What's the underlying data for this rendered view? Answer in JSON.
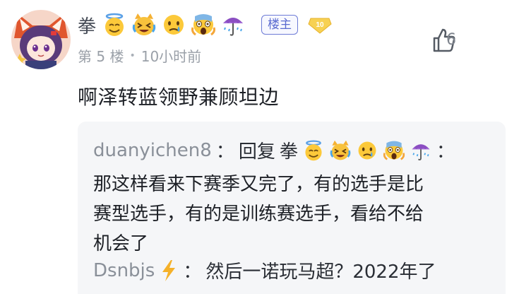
{
  "comment": {
    "username": "拳",
    "username_emojis": [
      "smiling-face-with-halo",
      "crying-cat",
      "sad-relieved-face",
      "screaming-face",
      "umbrella-rain"
    ],
    "op_badge": "楼主",
    "level": "10",
    "floor": "第 5 楼",
    "time": "10小时前",
    "like_count": "6",
    "content": "啊泽转蓝领野兼顾坦边"
  },
  "replies": [
    {
      "author": "duanyichen8",
      "separator": "：",
      "reply_prefix": "回复",
      "reply_to": "拳",
      "reply_to_emojis": [
        "smiling-face-with-halo",
        "crying-cat",
        "sad-relieved-face",
        "screaming-face",
        "umbrella-rain"
      ],
      "text_line1": "那这样看来下赛季又完了，有的选手是比",
      "text_line2": "赛型选手，有的是训练赛选手，看给不给",
      "text_line3": "机会了"
    },
    {
      "author": "Dsnbjs",
      "author_icon": "lightning-icon",
      "separator": "：",
      "text": "然后一诺玩马超？2022年了"
    }
  ],
  "colors": {
    "op_badge": "#5b6bd0",
    "level_badge": "#f2c23b",
    "meta_text": "#9aa0a8",
    "reply_bg": "#f5f6f8"
  }
}
